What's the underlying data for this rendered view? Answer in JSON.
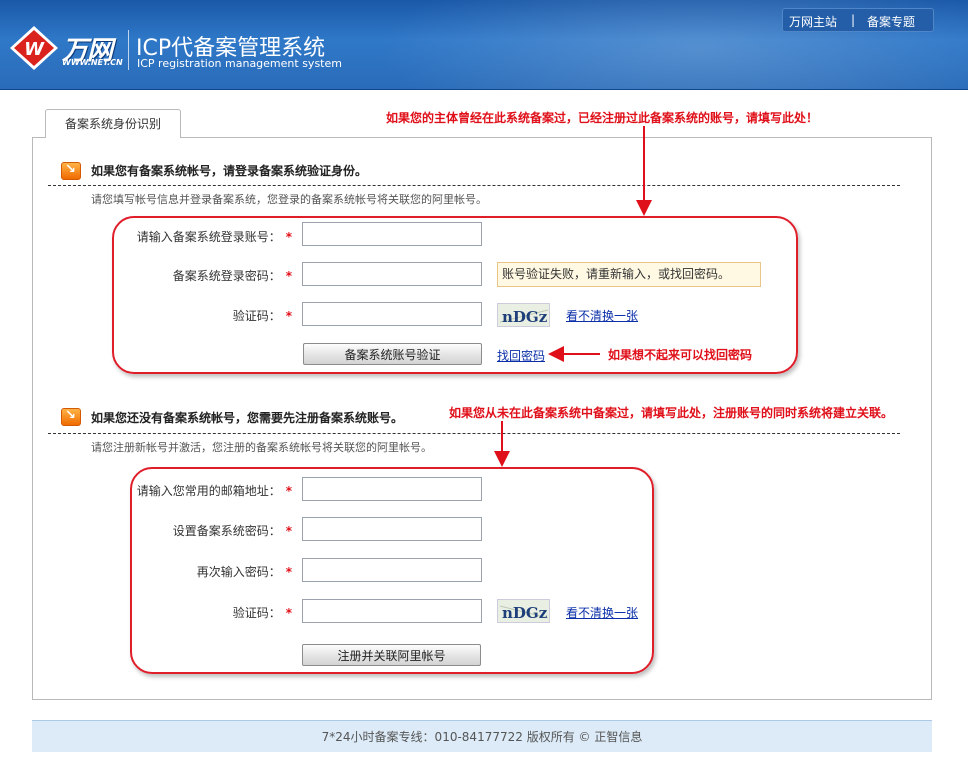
{
  "header": {
    "logo_text": "万网",
    "logo_url": "WWW.NET.CN",
    "title": "ICP代备案管理系统",
    "subtitle": "ICP registration management system",
    "nav": [
      {
        "label": "万网主站"
      },
      {
        "label": "备案专题"
      }
    ],
    "nav_separator": "|"
  },
  "tab": {
    "label": "备案系统身份识别"
  },
  "login_section": {
    "title": "如果您有备案系统帐号，请登录备案系统验证身份。",
    "description": "请您填写帐号信息并登录备案系统，您登录的备案系统帐号将关联您的阿里帐号。",
    "fields": [
      {
        "label": "请输入备案系统登录账号：",
        "value": ""
      },
      {
        "label": "备案系统登录密码：",
        "value": ""
      },
      {
        "label": "验证码：",
        "value": ""
      }
    ],
    "required_mark": "*",
    "error_message": "账号验证失败，请重新输入，或找回密码。",
    "captcha_text": "nDGz",
    "refresh_captcha": "看不清换一张",
    "submit_button": "备案系统账号验证",
    "forgot_password": "找回密码"
  },
  "register_section": {
    "title": "如果您还没有备案系统帐号，您需要先注册备案系统账号。",
    "description": "请您注册新帐号并激活，您注册的备案系统帐号将关联您的阿里帐号。",
    "fields": [
      {
        "label": "请输入您常用的邮箱地址：",
        "value": ""
      },
      {
        "label": "设置备案系统密码：",
        "value": ""
      },
      {
        "label": "再次输入密码：",
        "value": ""
      },
      {
        "label": "验证码：",
        "value": ""
      }
    ],
    "captcha_text": "nDGz",
    "refresh_captcha": "看不清换一张",
    "submit_button": "注册并关联阿里帐号"
  },
  "annotations": {
    "top_note": "如果您的主体曾经在此系统备案过，已经注册过此备案系统的账号，请填写此处！",
    "forgot_note": "如果想不起来可以找回密码",
    "register_note": "如果您从未在此备案系统中备案过，请填写此处，注册账号的同时系统将建立关联。"
  },
  "footer": {
    "text": "7*24小时备案专线：010-84177722  版权所有 © 正智信息"
  },
  "colors": {
    "header_blue": "#2a6cb9",
    "annotation_red": "#e0101a",
    "link_blue": "#0a2fa8",
    "footer_bg": "#dcebf7"
  }
}
